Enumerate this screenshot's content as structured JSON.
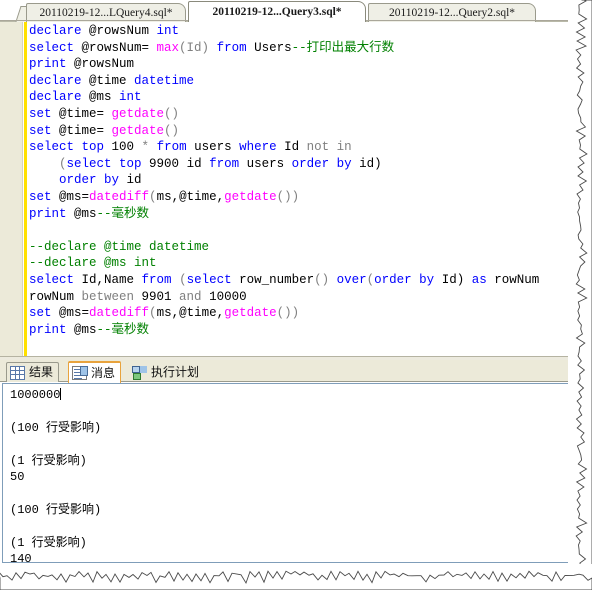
{
  "window": {
    "app": "SQL Server Management Studio query editor"
  },
  "editor_tabs": [
    {
      "label": "20110219-12...LQuery4.sql*",
      "active": false
    },
    {
      "label": "20110219-12...Query3.sql*",
      "active": true
    },
    {
      "label": "20110219-12...Query2.sql*",
      "active": false
    }
  ],
  "code": {
    "lines": [
      [
        {
          "t": "declare ",
          "c": "kw"
        },
        {
          "t": "@rowsNum ",
          "c": "txt"
        },
        {
          "t": "int",
          "c": "kw"
        }
      ],
      [
        {
          "t": "select ",
          "c": "kw"
        },
        {
          "t": "@rowsNum= ",
          "c": "txt"
        },
        {
          "t": "max",
          "c": "fn"
        },
        {
          "t": "(Id) ",
          "c": "gry"
        },
        {
          "t": "from ",
          "c": "kw"
        },
        {
          "t": "Users",
          "c": "txt"
        },
        {
          "t": "--打印出最大行数",
          "c": "cmt"
        }
      ],
      [
        {
          "t": "print ",
          "c": "kw"
        },
        {
          "t": "@rowsNum",
          "c": "txt"
        }
      ],
      [
        {
          "t": "declare ",
          "c": "kw"
        },
        {
          "t": "@time ",
          "c": "txt"
        },
        {
          "t": "datetime",
          "c": "kw"
        }
      ],
      [
        {
          "t": "declare ",
          "c": "kw"
        },
        {
          "t": "@ms ",
          "c": "txt"
        },
        {
          "t": "int",
          "c": "kw"
        }
      ],
      [
        {
          "t": "set ",
          "c": "kw"
        },
        {
          "t": "@time= ",
          "c": "txt"
        },
        {
          "t": "getdate",
          "c": "fn"
        },
        {
          "t": "()",
          "c": "gry"
        }
      ],
      [
        {
          "t": "set ",
          "c": "kw"
        },
        {
          "t": "@time= ",
          "c": "txt"
        },
        {
          "t": "getdate",
          "c": "fn"
        },
        {
          "t": "()",
          "c": "gry"
        }
      ],
      [
        {
          "t": "select ",
          "c": "kw"
        },
        {
          "t": "top ",
          "c": "kw"
        },
        {
          "t": "100 ",
          "c": "num"
        },
        {
          "t": "* ",
          "c": "gry"
        },
        {
          "t": "from ",
          "c": "kw"
        },
        {
          "t": "users ",
          "c": "txt"
        },
        {
          "t": "where ",
          "c": "kw"
        },
        {
          "t": "Id ",
          "c": "txt"
        },
        {
          "t": "not ",
          "c": "gry"
        },
        {
          "t": "in",
          "c": "gry"
        }
      ],
      [
        {
          "t": "    (",
          "c": "gry"
        },
        {
          "t": "select ",
          "c": "kw"
        },
        {
          "t": "top ",
          "c": "kw"
        },
        {
          "t": "9900 ",
          "c": "num"
        },
        {
          "t": "id ",
          "c": "txt"
        },
        {
          "t": "from ",
          "c": "kw"
        },
        {
          "t": "users ",
          "c": "txt"
        },
        {
          "t": "order ",
          "c": "kw"
        },
        {
          "t": "by ",
          "c": "kw"
        },
        {
          "t": "id)",
          "c": "txt"
        }
      ],
      [
        {
          "t": "    ",
          "c": "txt"
        },
        {
          "t": "order ",
          "c": "kw"
        },
        {
          "t": "by ",
          "c": "kw"
        },
        {
          "t": "id",
          "c": "txt"
        }
      ],
      [
        {
          "t": "set ",
          "c": "kw"
        },
        {
          "t": "@ms=",
          "c": "txt"
        },
        {
          "t": "datediff",
          "c": "fn"
        },
        {
          "t": "(",
          "c": "gry"
        },
        {
          "t": "ms,",
          "c": "txt"
        },
        {
          "t": "@time,",
          "c": "txt"
        },
        {
          "t": "getdate",
          "c": "fn"
        },
        {
          "t": "())",
          "c": "gry"
        }
      ],
      [
        {
          "t": "print ",
          "c": "kw"
        },
        {
          "t": "@ms",
          "c": "txt"
        },
        {
          "t": "--毫秒数",
          "c": "cmt"
        }
      ],
      [
        {
          "t": "",
          "c": "txt"
        }
      ],
      [
        {
          "t": "--declare @time datetime",
          "c": "cmt"
        }
      ],
      [
        {
          "t": "--declare @ms int",
          "c": "cmt"
        }
      ],
      [
        {
          "t": "select ",
          "c": "kw"
        },
        {
          "t": "Id,",
          "c": "txt"
        },
        {
          "t": "Name ",
          "c": "txt"
        },
        {
          "t": "from ",
          "c": "kw"
        },
        {
          "t": "(",
          "c": "gry"
        },
        {
          "t": "select ",
          "c": "kw"
        },
        {
          "t": "row_number",
          "c": "txt"
        },
        {
          "t": "() ",
          "c": "gry"
        },
        {
          "t": "over",
          "c": "kw"
        },
        {
          "t": "(",
          "c": "gry"
        },
        {
          "t": "order ",
          "c": "kw"
        },
        {
          "t": "by ",
          "c": "kw"
        },
        {
          "t": "Id) ",
          "c": "txt"
        },
        {
          "t": "as ",
          "c": "kw"
        },
        {
          "t": "rowNum",
          "c": "txt"
        }
      ],
      [
        {
          "t": "rowNum ",
          "c": "txt"
        },
        {
          "t": "between ",
          "c": "gry"
        },
        {
          "t": "9901 ",
          "c": "num"
        },
        {
          "t": "and ",
          "c": "gry"
        },
        {
          "t": "10000",
          "c": "num"
        }
      ],
      [
        {
          "t": "set ",
          "c": "kw"
        },
        {
          "t": "@ms=",
          "c": "txt"
        },
        {
          "t": "datediff",
          "c": "fn"
        },
        {
          "t": "(",
          "c": "gry"
        },
        {
          "t": "ms,",
          "c": "txt"
        },
        {
          "t": "@time,",
          "c": "txt"
        },
        {
          "t": "getdate",
          "c": "fn"
        },
        {
          "t": "())",
          "c": "gry"
        }
      ],
      [
        {
          "t": "print ",
          "c": "kw"
        },
        {
          "t": "@ms",
          "c": "txt"
        },
        {
          "t": "--毫秒数",
          "c": "cmt"
        }
      ]
    ],
    "colors": {
      "keyword": "#0000ff",
      "function": "#ff00ff",
      "comment": "#008000",
      "punctuation": "#808080",
      "text": "#000000",
      "change_bar": "#ffe000",
      "gutter_bg": "#ecead9"
    }
  },
  "results_tabs": [
    {
      "label": "结果",
      "icon": "grid-icon",
      "active": false
    },
    {
      "label": "消息",
      "icon": "message-page-icon",
      "active": true
    },
    {
      "label": "执行计划",
      "icon": "execution-plan-icon",
      "active": false
    }
  ],
  "messages": {
    "lines": [
      "1000000",
      "",
      "(100 行受影响)",
      "",
      "(1 行受影响)",
      "50",
      "",
      "(100 行受影响)",
      "",
      "(1 行受影响)",
      "140"
    ]
  }
}
